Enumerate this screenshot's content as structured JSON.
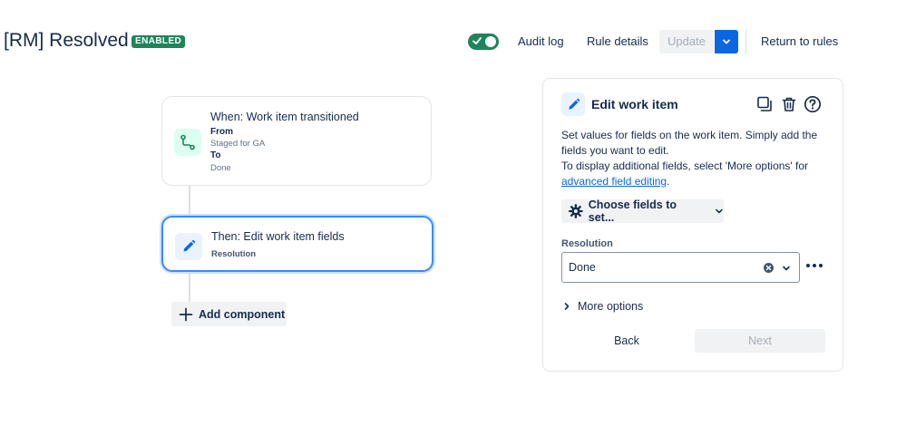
{
  "header": {
    "title": "[RM] Resolved",
    "badge": "ENABLED",
    "toggle_on": true,
    "audit_log": "Audit log",
    "rule_details": "Rule details",
    "update": "Update",
    "return_to_rules": "Return to rules"
  },
  "canvas": {
    "trigger": {
      "title": "When: Work item transitioned",
      "from_label": "From",
      "from_value": "Staged for GA",
      "to_label": "To",
      "to_value": "Done"
    },
    "action": {
      "title": "Then: Edit work item fields",
      "field": "Resolution"
    },
    "add_component": "Add component"
  },
  "panel": {
    "title": "Edit work item",
    "desc_line1": "Set values for fields on the work item. Simply add the fields you want to edit.",
    "desc_line2": "To display additional fields, select 'More options' for",
    "desc_link": "advanced field editing",
    "desc_end": ".",
    "choose_fields": "Choose fields to set...",
    "field_label": "Resolution",
    "field_value": "Done",
    "more_options": "More options",
    "back": "Back",
    "next": "Next"
  },
  "colors": {
    "accent": "#0c66e4",
    "success": "#1f845a",
    "focus_border": "#388bff"
  },
  "icons": [
    "check-icon",
    "chevron-down-icon",
    "branch-icon",
    "pencil-icon",
    "plus-icon",
    "copy-icon",
    "trash-icon",
    "help-icon",
    "gear-icon",
    "clear-icon",
    "more-icon",
    "chevron-right-icon"
  ]
}
